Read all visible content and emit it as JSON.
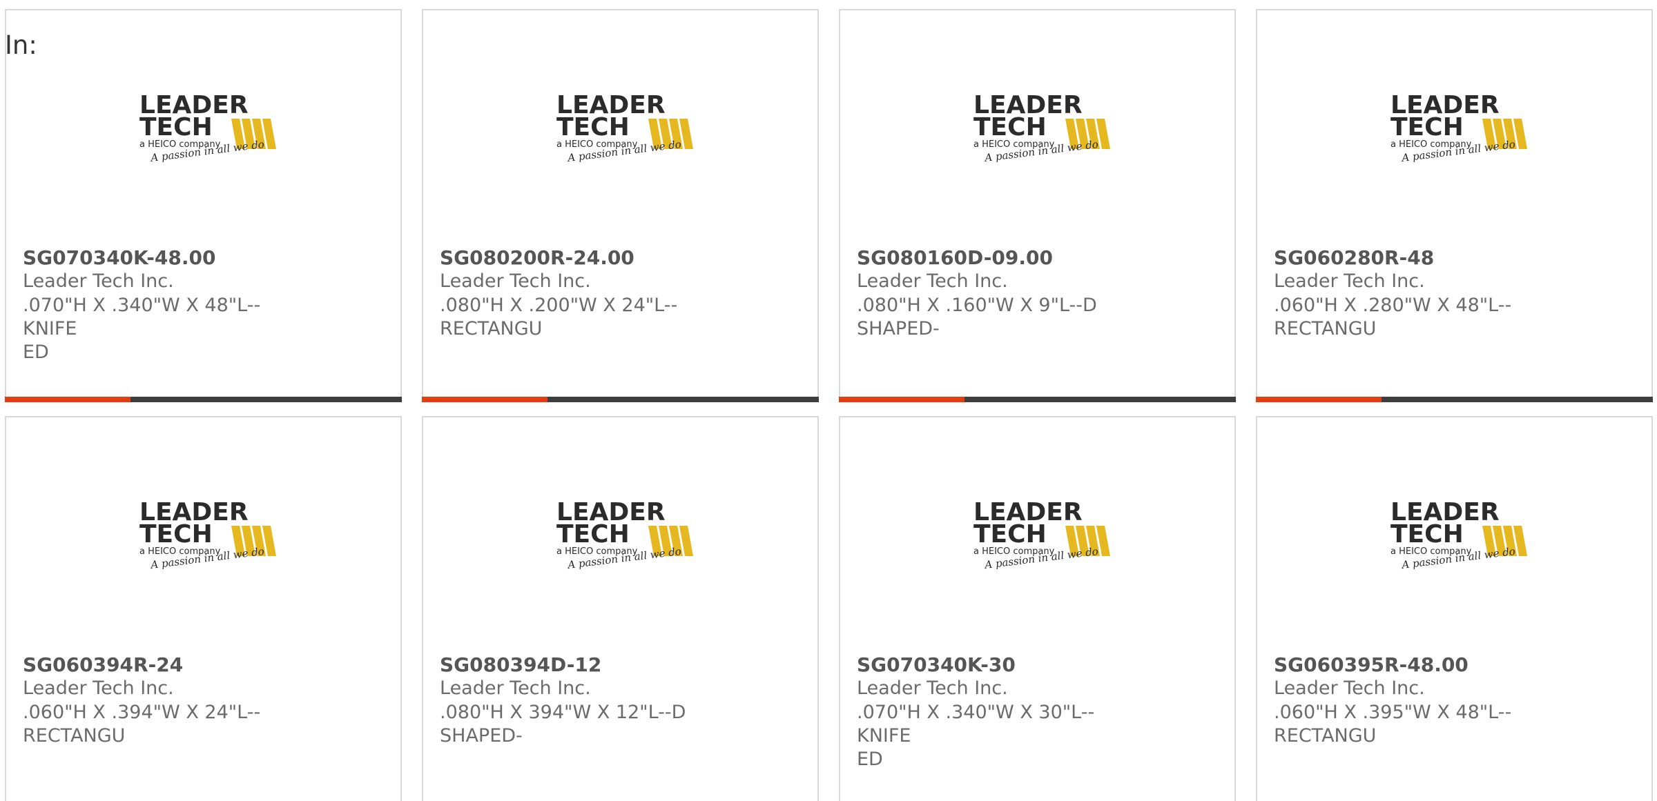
{
  "filter": {
    "label": "In:"
  },
  "brand": {
    "logo_line1": "LEADER",
    "logo_line2": "TECH",
    "logo_line3": "a HEICO company",
    "logo_tagline": "A passion in all we do",
    "colors": {
      "accent": "#e43d12",
      "track": "#3e3e3e",
      "logo_gold": "#e5b81f"
    }
  },
  "products": [
    {
      "part_number": "SG070340K-48.00",
      "manufacturer": "Leader Tech Inc.",
      "description": ".070\"H X .340\"W X 48\"L--KNIFE\nED"
    },
    {
      "part_number": "SG080200R-24.00",
      "manufacturer": "Leader Tech Inc.",
      "description": ".080\"H X .200\"W X 24\"L--\nRECTANGU"
    },
    {
      "part_number": "SG080160D-09.00",
      "manufacturer": "Leader Tech Inc.",
      "description": ".080\"H X .160\"W X 9\"L--D\nSHAPED-"
    },
    {
      "part_number": "SG060280R-48",
      "manufacturer": "Leader Tech Inc.",
      "description": ".060\"H X .280\"W X 48\"L--\nRECTANGU"
    },
    {
      "part_number": "SG060394R-24",
      "manufacturer": "Leader Tech Inc.",
      "description": ".060\"H X .394\"W X 24\"L--\nRECTANGU"
    },
    {
      "part_number": "SG080394D-12",
      "manufacturer": "Leader Tech Inc.",
      "description": ".080\"H X 394\"W X 12\"L--D\nSHAPED-"
    },
    {
      "part_number": "SG070340K-30",
      "manufacturer": "Leader Tech Inc.",
      "description": ".070\"H X .340\"W X 30\"L--KNIFE\nED"
    },
    {
      "part_number": "SG060395R-48.00",
      "manufacturer": "Leader Tech Inc.",
      "description": ".060\"H X .395\"W X 48\"L--\nRECTANGU"
    }
  ]
}
